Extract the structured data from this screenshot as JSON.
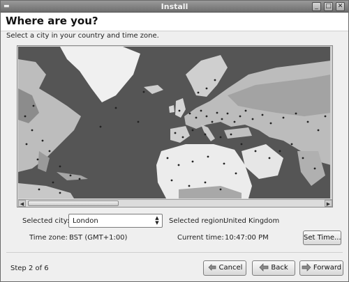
{
  "window": {
    "title": "Install",
    "controls": {
      "minimize": "_",
      "maximize": "□",
      "close": "✕"
    },
    "app_icon": "gnome-menu-icon"
  },
  "header": {
    "title": "Where are you?"
  },
  "instruction": "Select a city in your country and time zone.",
  "map": {
    "region_shown": "North Atlantic, Europe, Africa, Middle East",
    "colors": {
      "ocean": "#555555",
      "land": "#cfcfcf",
      "land_dark": "#8c8c8c",
      "city_dot": "#222222"
    }
  },
  "location": {
    "selected_city_label": "Selected city:",
    "selected_city_value": "London",
    "selected_region_label": "Selected region:",
    "selected_region_value": "United Kingdom",
    "time_zone_label": "Time zone:",
    "time_zone_value": "BST (GMT+1:00)",
    "current_time_label": "Current time:",
    "current_time_value": "10:47:00 PM",
    "set_time_button": "Set Time..."
  },
  "footer": {
    "step": "Step 2 of 6",
    "cancel": "Cancel",
    "back": "Back",
    "forward": "Forward"
  }
}
